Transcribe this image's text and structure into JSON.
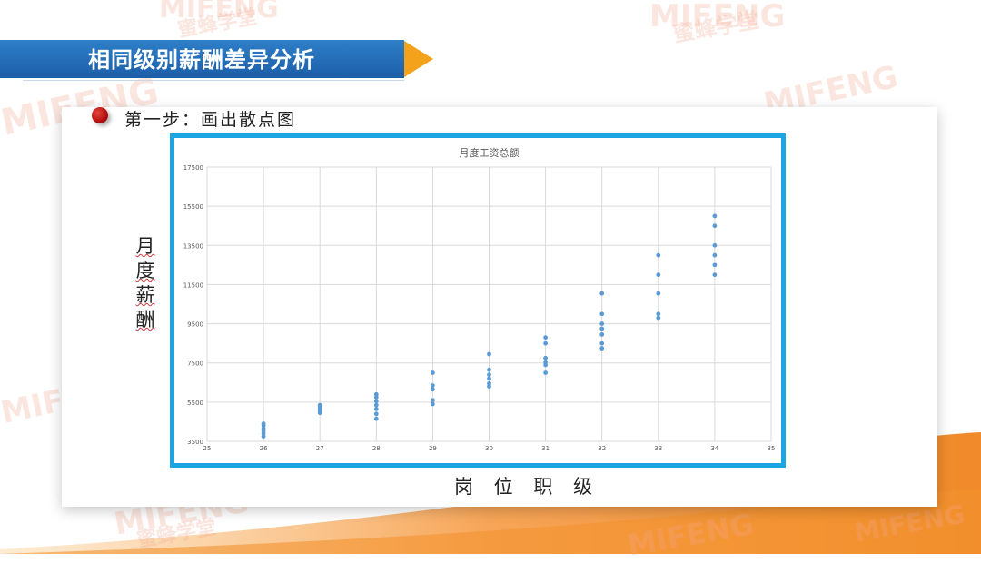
{
  "header": {
    "title": "相同级别薪酬差异分析"
  },
  "step": {
    "label": "第一步：画出散点图"
  },
  "axis_titles": {
    "y_chars": [
      "月",
      "度",
      "薪",
      "酬"
    ],
    "x": "岗 位 职 级"
  },
  "watermark": {
    "logo_text": "MIFENG",
    "cn_text": "蜜蜂学堂"
  },
  "colors": {
    "title_bar": "#1c5ea8",
    "arrow": "#f4a21c",
    "frame": "#1ba6e3",
    "points": "#5b9bd5",
    "step_dot": "#c0141c"
  },
  "chart_data": {
    "type": "scatter",
    "title": "月度工资总额",
    "xlabel": "",
    "ylabel": "",
    "xlim": [
      25,
      35
    ],
    "ylim": [
      3500,
      17500
    ],
    "x_ticks": [
      25,
      26,
      27,
      28,
      29,
      30,
      31,
      32,
      33,
      34,
      35
    ],
    "y_ticks": [
      3500,
      5500,
      7500,
      9500,
      11500,
      13500,
      15500,
      17500
    ],
    "grid": true,
    "points": [
      [
        26,
        3750
      ],
      [
        26,
        3900
      ],
      [
        26,
        4050
      ],
      [
        26,
        4150
      ],
      [
        26,
        4300
      ],
      [
        26,
        4400
      ],
      [
        27,
        4950
      ],
      [
        27,
        5050
      ],
      [
        27,
        5150
      ],
      [
        27,
        5250
      ],
      [
        27,
        5350
      ],
      [
        28,
        4650
      ],
      [
        28,
        4900
      ],
      [
        28,
        5150
      ],
      [
        28,
        5350
      ],
      [
        28,
        5550
      ],
      [
        28,
        5750
      ],
      [
        28,
        5900
      ],
      [
        29,
        5400
      ],
      [
        29,
        5600
      ],
      [
        29,
        6150
      ],
      [
        29,
        6350
      ],
      [
        29,
        7000
      ],
      [
        30,
        6300
      ],
      [
        30,
        6450
      ],
      [
        30,
        6700
      ],
      [
        30,
        6900
      ],
      [
        30,
        7150
      ],
      [
        30,
        7950
      ],
      [
        31,
        7000
      ],
      [
        31,
        7400
      ],
      [
        31,
        7550
      ],
      [
        31,
        7750
      ],
      [
        31,
        8500
      ],
      [
        31,
        8800
      ],
      [
        32,
        8250
      ],
      [
        32,
        8500
      ],
      [
        32,
        8950
      ],
      [
        32,
        9250
      ],
      [
        32,
        9500
      ],
      [
        32,
        10000
      ],
      [
        32,
        11050
      ],
      [
        33,
        9800
      ],
      [
        33,
        10000
      ],
      [
        33,
        11050
      ],
      [
        33,
        12000
      ],
      [
        33,
        13000
      ],
      [
        34,
        12000
      ],
      [
        34,
        12500
      ],
      [
        34,
        13000
      ],
      [
        34,
        13500
      ],
      [
        34,
        14500
      ],
      [
        34,
        15000
      ]
    ]
  }
}
